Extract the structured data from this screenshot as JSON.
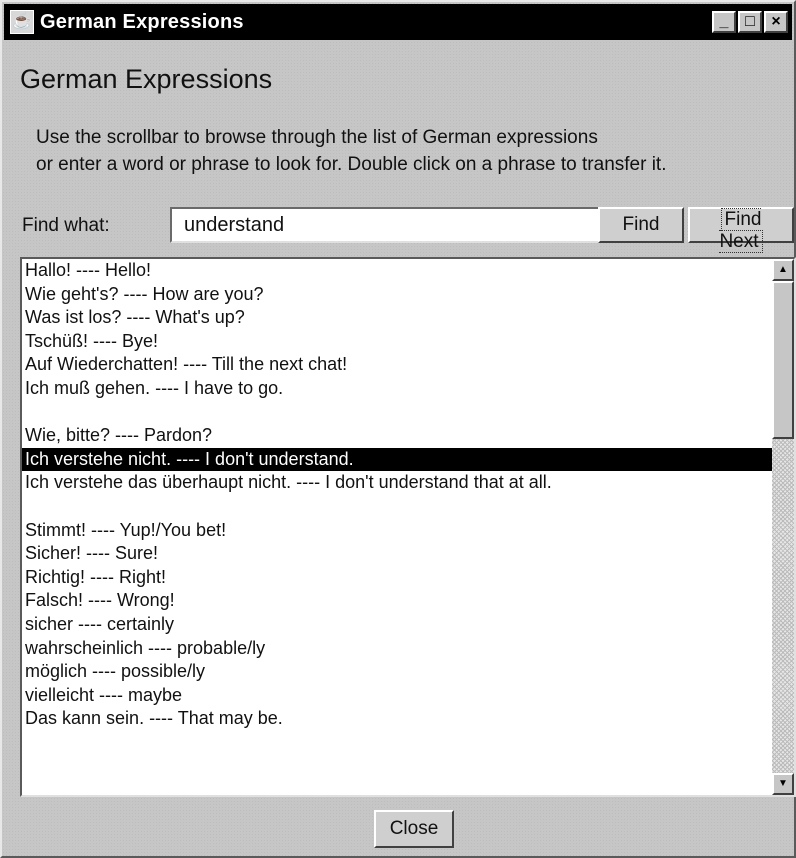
{
  "window": {
    "title": "German Expressions",
    "icon": "app-icon",
    "controls": {
      "minimize": "_",
      "maximize": "□",
      "close": "×"
    }
  },
  "heading": "German Expressions",
  "instructions": {
    "line1": "Use the scrollbar to browse through the list of German expressions",
    "line2": "or enter a word or phrase to look for. Double click on a phrase to transfer it."
  },
  "find": {
    "label": "Find what:",
    "value": "understand",
    "find_button": "Find",
    "find_next_button": "Find Next"
  },
  "list": {
    "selected_index": 8,
    "items": [
      "Hallo! ---- Hello!",
      "Wie geht's? ---- How are you?",
      "Was ist los? ---- What's up?",
      "Tschüß! ---- Bye!",
      "Auf Wiederchatten! ---- Till the next chat!",
      "Ich muß gehen. ---- I have to go.",
      "",
      "Wie, bitte? ---- Pardon?",
      "Ich verstehe nicht. ---- I don't understand.",
      "Ich verstehe das überhaupt nicht. ---- I don't understand that at all.",
      "",
      "Stimmt! ---- Yup!/You bet!",
      "Sicher! ---- Sure!",
      "Richtig! ---- Right!",
      "Falsch! ---- Wrong!",
      "sicher ---- certainly",
      "wahrscheinlich ---- probable/ly",
      "möglich ---- possible/ly",
      "vielleicht ---- maybe",
      "Das kann sein. ---- That may be."
    ]
  },
  "close_button": "Close"
}
